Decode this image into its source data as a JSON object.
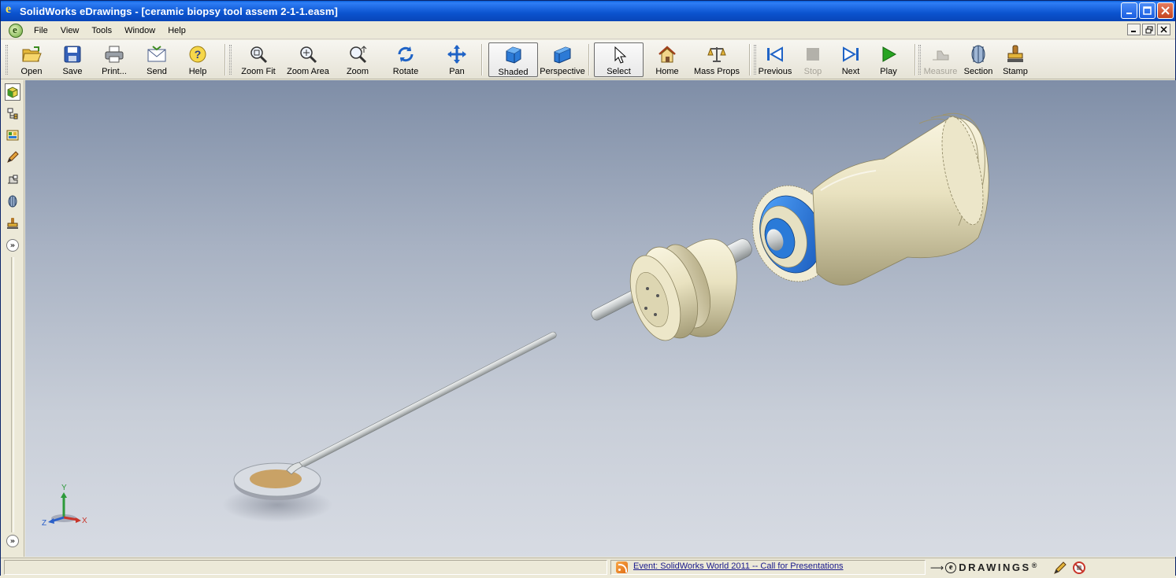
{
  "window": {
    "title": "SolidWorks eDrawings - [ceramic biopsy tool assem 2-1-1.easm]",
    "app_icon": "edrawings-e-icon",
    "controls": [
      "minimize-icon",
      "maximize-icon",
      "close-icon"
    ]
  },
  "menu": {
    "items": [
      "File",
      "View",
      "Tools",
      "Window",
      "Help"
    ],
    "mdi_controls": [
      "_",
      "🗗",
      "✕"
    ]
  },
  "toolbar": {
    "buttons": [
      {
        "label": "Open",
        "icon": "folder-open-icon",
        "enabled": true
      },
      {
        "label": "Save",
        "icon": "floppy-disk-icon",
        "enabled": true
      },
      {
        "label": "Print...",
        "icon": "printer-icon",
        "enabled": true
      },
      {
        "label": "Send",
        "icon": "envelope-icon",
        "enabled": true
      },
      {
        "label": "Help",
        "icon": "help-question-icon",
        "enabled": true
      },
      {
        "label": "Zoom Fit",
        "icon": "zoom-fit-icon",
        "enabled": true
      },
      {
        "label": "Zoom Area",
        "icon": "zoom-area-icon",
        "enabled": true
      },
      {
        "label": "Zoom",
        "icon": "zoom-icon",
        "enabled": true
      },
      {
        "label": "Rotate",
        "icon": "rotate-icon",
        "enabled": true
      },
      {
        "label": "Pan",
        "icon": "pan-arrows-icon",
        "enabled": true
      },
      {
        "label": "Shaded",
        "icon": "shaded-cube-icon",
        "enabled": true,
        "pressed": true
      },
      {
        "label": "Perspective",
        "icon": "perspective-box-icon",
        "enabled": true
      },
      {
        "label": "Select",
        "icon": "select-arrow-icon",
        "enabled": true,
        "pressed": true
      },
      {
        "label": "Home",
        "icon": "home-icon",
        "enabled": true
      },
      {
        "label": "Mass Props",
        "icon": "scale-balance-icon",
        "enabled": true
      },
      {
        "label": "Previous",
        "icon": "previous-icon",
        "enabled": true
      },
      {
        "label": "Stop",
        "icon": "stop-icon",
        "enabled": false
      },
      {
        "label": "Next",
        "icon": "next-icon",
        "enabled": true
      },
      {
        "label": "Play",
        "icon": "play-icon",
        "enabled": true
      },
      {
        "label": "Measure",
        "icon": "measure-icon",
        "enabled": false
      },
      {
        "label": "Section",
        "icon": "section-icon",
        "enabled": true
      },
      {
        "label": "Stamp",
        "icon": "stamp-icon",
        "enabled": true
      }
    ]
  },
  "sidebar": {
    "buttons": [
      "components-icon",
      "configurations-icon",
      "parts-icon",
      "markup-icon",
      "measure-tab-icon",
      "section-tab-icon",
      "stamp-tab-icon"
    ],
    "expand_symbol": "»"
  },
  "viewport": {
    "model": "ceramic biopsy tool assembly",
    "triad": {
      "x": "X",
      "y": "Y",
      "z": "Z"
    }
  },
  "status": {
    "event_text": "Event: SolidWorks World 2011 -- Call for Presentations",
    "brand": "DRAWINGS",
    "brand_prefix": "e",
    "registered": "®"
  },
  "colors": {
    "titlebar": "#0b53cf",
    "viewport_top": "#7f8ea7",
    "viewport_bottom": "#d7dbe3",
    "model_ivory": "#e9e4c6",
    "model_blue": "#2a7ad8",
    "tip_gold": "#c9a266"
  }
}
